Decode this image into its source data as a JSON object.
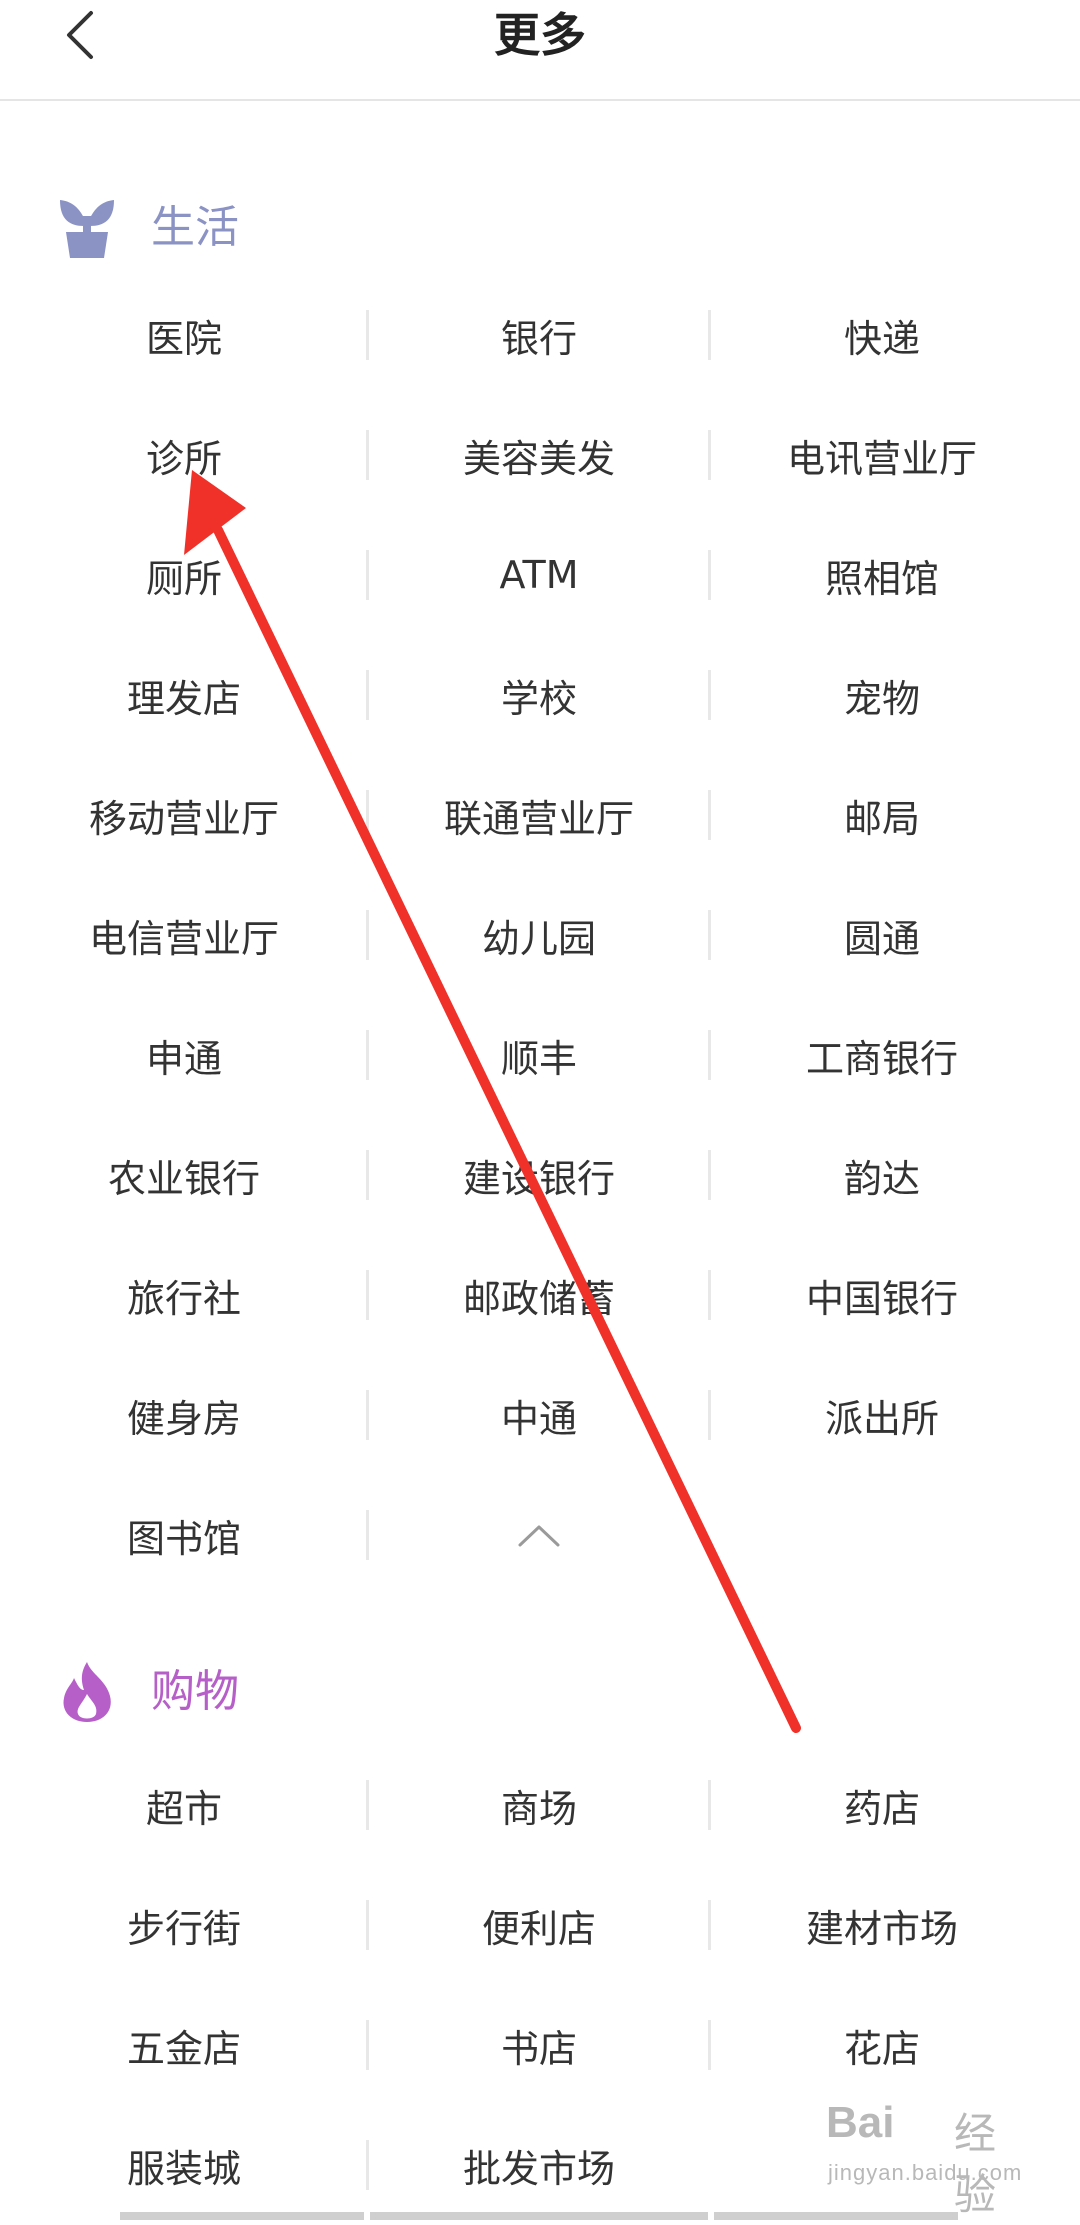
{
  "header": {
    "title": "更多"
  },
  "sections": [
    {
      "title": "生活",
      "title_color": "#8b93c4",
      "icon": "sprout-icon",
      "items": [
        "医院",
        "银行",
        "快递",
        "诊所",
        "美容美发",
        "电讯营业厅",
        "厕所",
        "ATM",
        "照相馆",
        "理发店",
        "学校",
        "宠物",
        "移动营业厅",
        "联通营业厅",
        "邮局",
        "电信营业厅",
        "幼儿园",
        "圆通",
        "申通",
        "顺丰",
        "工商银行",
        "农业银行",
        "建设银行",
        "韵达",
        "旅行社",
        "邮政储蓄",
        "中国银行",
        "健身房",
        "中通",
        "派出所",
        "图书馆"
      ],
      "collapse_icon": "chevron-up-icon"
    },
    {
      "title": "购物",
      "title_color": "#b65fc8",
      "icon": "flame-icon",
      "items": [
        "超市",
        "商场",
        "药店",
        "步行街",
        "便利店",
        "建材市场",
        "五金店",
        "书店",
        "花店",
        "服装城",
        "批发市场"
      ]
    }
  ],
  "watermark": {
    "logo": "Bai",
    "brand": "经验",
    "domain": "jingyan.baidu.com"
  },
  "colors": {
    "annotation_arrow": "#f0312a",
    "divider": "#e8e8e8"
  }
}
